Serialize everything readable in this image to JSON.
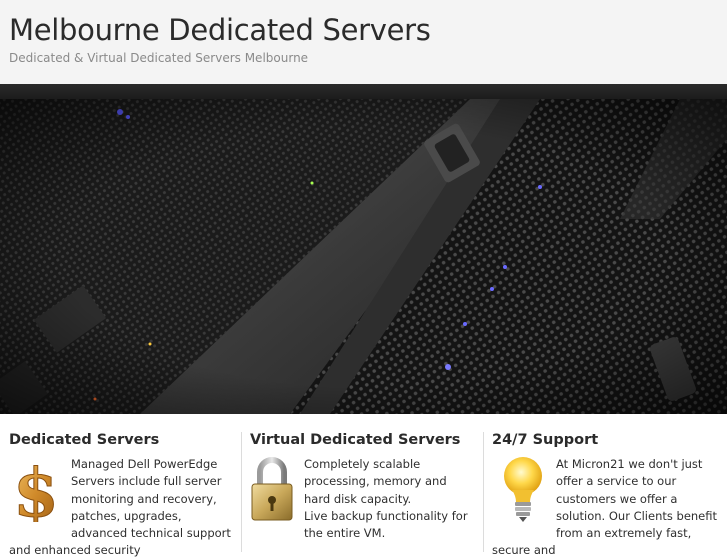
{
  "header": {
    "title": "Melbourne Dedicated Servers",
    "tagline": "Dedicated & Virtual Dedicated Servers Melbourne"
  },
  "features": [
    {
      "title": "Dedicated Servers",
      "icon": "dollar-icon",
      "text": "Managed Dell PowerEdge Servers include full server monitoring and recovery, patches, upgrades, advanced technical support and enhanced security"
    },
    {
      "title": "Virtual Dedicated Servers",
      "icon": "padlock-icon",
      "text": "Completely scalable processing, memory and hard disk capacity.",
      "text2": "Live backup functionality for the entire VM."
    },
    {
      "title": "24/7 Support",
      "icon": "lightbulb-icon",
      "text": "At Micron21 we don't just offer a service to our customers we offer a solution. Our Clients benefit from an extremely fast, secure and"
    }
  ],
  "colors": {
    "header_bg": "#f4f4f4",
    "title": "#2b2b2b",
    "tagline": "#8a8a8a",
    "bar": "#222222"
  }
}
